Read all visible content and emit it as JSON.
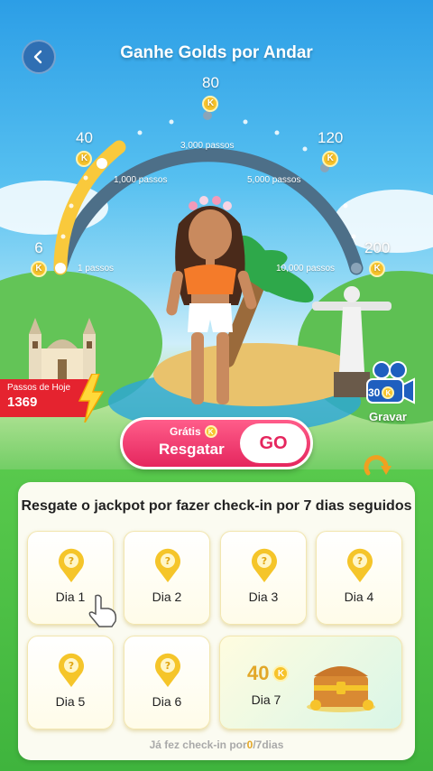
{
  "header": {
    "title": "Ganhe Golds por Andar"
  },
  "gauge": {
    "milestones": [
      {
        "reward": "6"
      },
      {
        "reward": "40"
      },
      {
        "reward": "80"
      },
      {
        "reward": "120"
      },
      {
        "reward": "200"
      }
    ],
    "step_labels": [
      "1 passos",
      "1,000 passos",
      "3,000 passos",
      "5,000 passos",
      "10,000 passos"
    ],
    "progress_colors": {
      "done": "#f9c93c",
      "pending": "#4d6f88"
    },
    "coin_symbol": "K"
  },
  "today_steps": {
    "label": "Passos de Hoje",
    "value": "1369"
  },
  "record": {
    "label": "Gravar",
    "reward": "30",
    "icon": "camera-icon"
  },
  "claim": {
    "free_label": "Grátis",
    "label": "Resgatar",
    "go_label": "GO"
  },
  "checkin": {
    "title": "Resgate o jackpot por fazer check-in por 7 dias seguidos",
    "days": [
      {
        "label": "Dia 1"
      },
      {
        "label": "Dia 2"
      },
      {
        "label": "Dia 3"
      },
      {
        "label": "Dia 4"
      },
      {
        "label": "Dia 5"
      },
      {
        "label": "Dia 6"
      }
    ],
    "day7": {
      "label": "Dia 7",
      "reward": "40"
    },
    "footer_prefix": "Já fez check-in por",
    "footer_count": "0",
    "footer_suffix": "/7dias"
  },
  "colors": {
    "accent": "#e5265e",
    "gold": "#f7c32b",
    "alert": "#e5232f"
  }
}
